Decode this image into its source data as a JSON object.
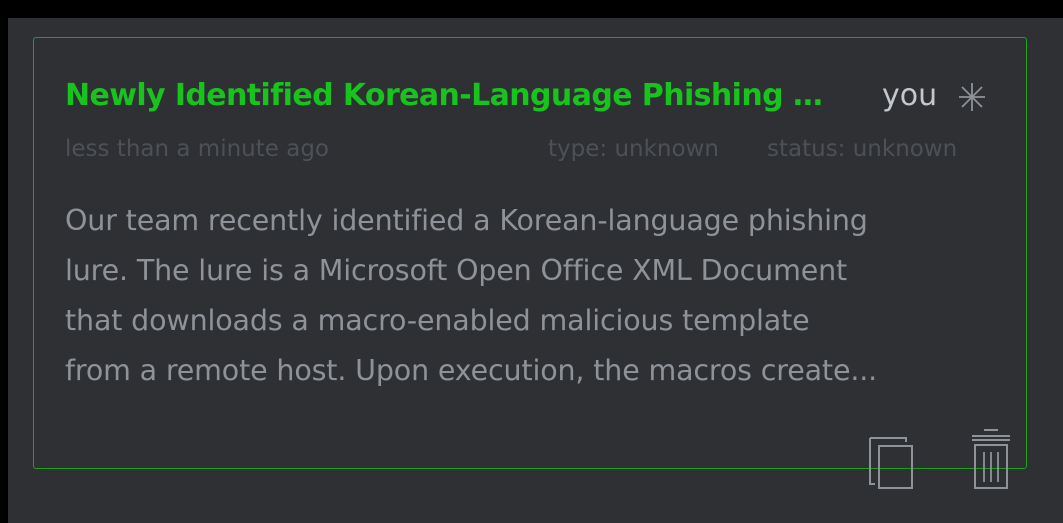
{
  "card": {
    "title": "Newly Identified Korean-Language Phishing Lure Uses Malicious Template",
    "author": "you",
    "time": "less than a minute ago",
    "type": "type: unknown",
    "status": "status: unknown",
    "description_lines": [
      "Our team recently identified a Korean-language phishing",
      "lure. The lure is a Microsoft Open Office XML Document",
      "that downloads a macro-enabled malicious template",
      "from a remote host. Upon execution, the macros create..."
    ]
  },
  "icons": {
    "pin": "pin-icon",
    "copy": "copy-icon",
    "trash": "trash-icon"
  },
  "colors": {
    "accent": "#1fa01f",
    "title": "#19c31e",
    "background": "#2e3034",
    "page_background": "#000000",
    "muted_text": "#4d5157",
    "body_text": "#8e939a",
    "icon": "#8e939a"
  }
}
